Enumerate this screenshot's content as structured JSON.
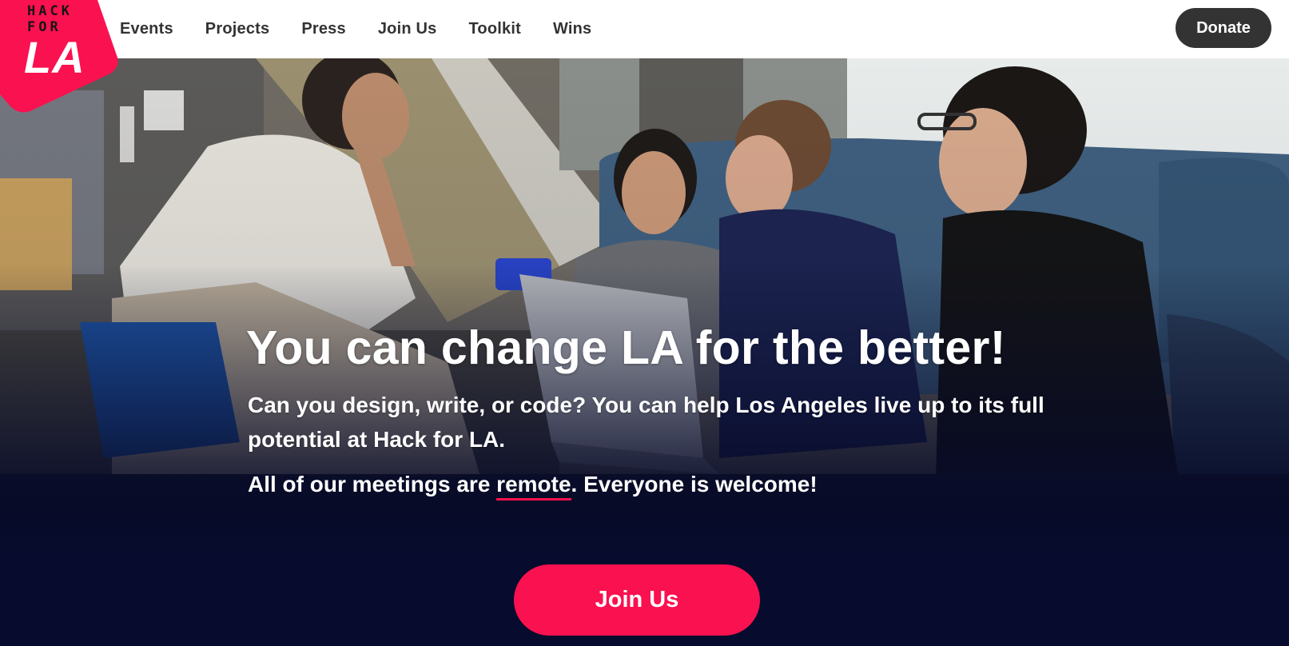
{
  "brand": {
    "logo_small": "HACK FOR",
    "logo_big": "LA",
    "accent_color": "#fa114f",
    "nav_bg": "#ffffff",
    "hero_bg": "#070b2e"
  },
  "nav": {
    "links": [
      "Events",
      "Projects",
      "Press",
      "Join Us",
      "Toolkit",
      "Wins"
    ],
    "donate_label": "Donate"
  },
  "hero": {
    "image_alt": "photo of four volunteers talking around a laptop on a couch",
    "headline": "You can change LA for the better!",
    "subtitle": "Can you design, write, or code? You can help Los Angeles live up to its full potential at Hack for LA.",
    "remote_prefix": "All of our meetings are ",
    "remote_link": "remote",
    "remote_suffix": ". Everyone is welcome!",
    "cta_label": "Join Us"
  }
}
